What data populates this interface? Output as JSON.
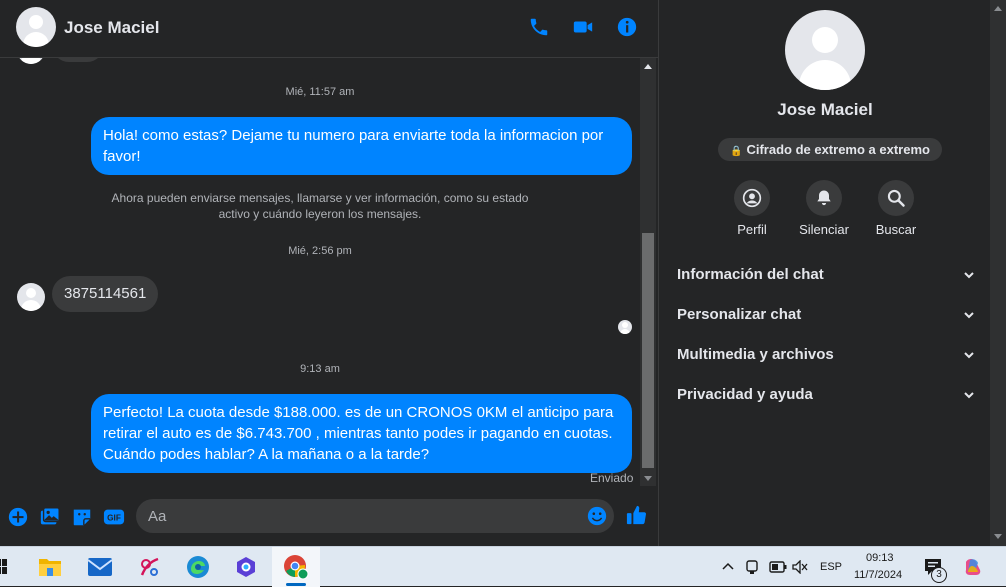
{
  "header": {
    "contact_name": "Jose Maciel"
  },
  "messages": {
    "timestamp_1": "Mié, 11:57 am",
    "out_1": "Hola! como estas? Dejame tu numero para enviarte toda la informacion por favor!",
    "system_notice": "Ahora pueden enviarse mensajes, llamarse y ver información, como su estado activo y cuándo leyeron los mensajes.",
    "timestamp_2": "Mié, 2:56 pm",
    "in_1": "3875114561",
    "timestamp_3": "9:13 am",
    "out_2": "Perfecto! La cuota desde $188.000. es de un CRONOS 0KM el anticipo para retirar el auto es de $6.743.700 , mientras tanto podes ir pagando en cuotas. Cuándo podes hablar? A la mañana o a la tarde?",
    "status": "Enviado"
  },
  "composer": {
    "placeholder": "Aa"
  },
  "panel": {
    "name": "Jose Maciel",
    "encryption": "Cifrado de extremo a extremo",
    "actions": [
      {
        "label": "Perfil",
        "icon": "profile-icon"
      },
      {
        "label": "Silenciar",
        "icon": "bell-icon"
      },
      {
        "label": "Buscar",
        "icon": "search-icon"
      }
    ],
    "sections": [
      "Información del chat",
      "Personalizar chat",
      "Multimedia y archivos",
      "Privacidad y ayuda"
    ]
  },
  "taskbar": {
    "language": "ESP",
    "time": "09:13",
    "date": "11/7/2024",
    "notification_count": "3"
  },
  "colors": {
    "accent": "#0084ff",
    "background": "#242526",
    "bubble_in": "#3a3b3c"
  }
}
